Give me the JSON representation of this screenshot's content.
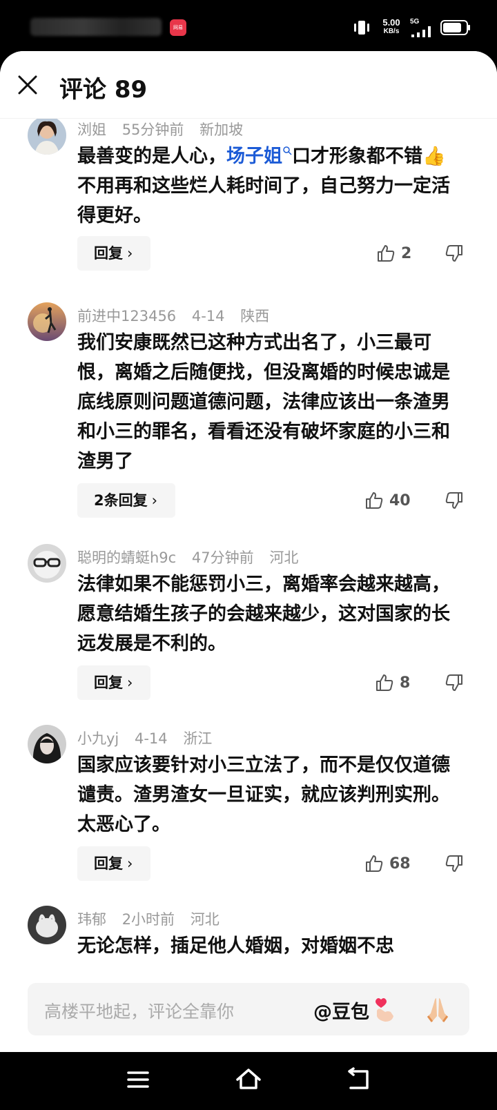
{
  "status_bar": {
    "app_badge": "网易",
    "speed_value": "5.00",
    "speed_unit": "KB/s",
    "network": "5G",
    "battery_icon": "battery-icon"
  },
  "header": {
    "title": "评论 89",
    "close_icon": "close-icon"
  },
  "comments": [
    {
      "user": "浏姐",
      "time": "55分钟前",
      "location": "新加坡",
      "text_before": "最善变的是人心，",
      "mention": "场子姐",
      "text_after": "口才形象都不错👍不用再和这些烂人耗时间了，自己努力一定活得更好。",
      "reply_label": "回复",
      "likes": "2"
    },
    {
      "user": "前进中123456",
      "time": "4-14",
      "location": "陕西",
      "text": "我们安康既然已这种方式出名了，小三最可恨，离婚之后随便找，但没离婚的时候忠诚是底线原则问题道德问题，法律应该出一条渣男和小三的罪名，看看还没有破坏家庭的小三和渣男了",
      "reply_label": "2条回复",
      "likes": "40"
    },
    {
      "user": "聪明的蜻蜓h9c",
      "time": "47分钟前",
      "location": "河北",
      "text": "法律如果不能惩罚小三，离婚率会越来越高，愿意结婚生孩子的会越来越少，这对国家的长远发展是不利的。",
      "reply_label": "回复",
      "likes": "8"
    },
    {
      "user": "小九yj",
      "time": "4-14",
      "location": "浙江",
      "text": "国家应该要针对小三立法了，而不是仅仅道德谴责。渣男渣女一旦证实，就应该判刑实刑。太恶心了。",
      "reply_label": "回复",
      "likes": "68"
    },
    {
      "user": "玮郁",
      "time": "2小时前",
      "location": "河北",
      "text": "无论怎样，插足他人婚姻，对婚姻不忠"
    }
  ],
  "input": {
    "placeholder": "高楼平地起，评论全靠你",
    "mention_label": "@豆包",
    "emoji_1": "heart-hand-emoji",
    "emoji_2": "pray-emoji"
  },
  "nav": {
    "menu_icon": "menu-icon",
    "home_icon": "home-icon",
    "back_icon": "back-icon"
  }
}
